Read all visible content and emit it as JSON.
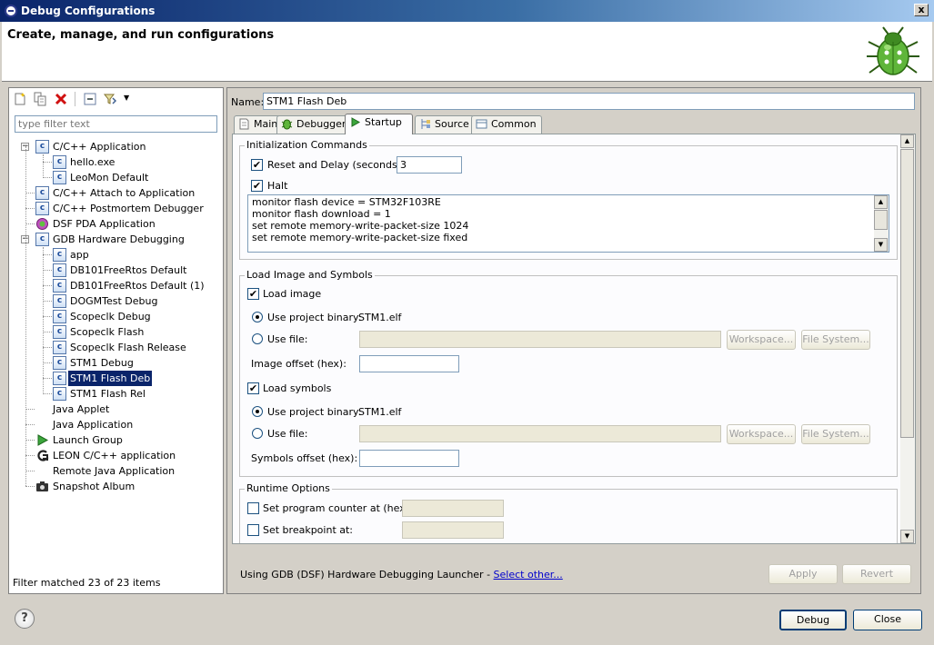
{
  "window": {
    "title": "Debug Configurations",
    "close_label": "x"
  },
  "header": {
    "title": "Create, manage, and run configurations"
  },
  "left": {
    "filter_placeholder": "type filter text",
    "filter_status": "Filter matched 23 of 23 items",
    "tree": [
      {
        "label": "C/C++ Application",
        "level": 0,
        "expanded": true,
        "icon": "c-config-icon"
      },
      {
        "label": "hello.exe",
        "level": 1,
        "icon": "c-config-icon"
      },
      {
        "label": "LeoMon Default",
        "level": 1,
        "icon": "c-config-icon"
      },
      {
        "label": "C/C++ Attach to Application",
        "level": 0,
        "icon": "c-config-icon"
      },
      {
        "label": "C/C++ Postmortem Debugger",
        "level": 0,
        "icon": "c-config-icon"
      },
      {
        "label": "DSF PDA Application",
        "level": 0,
        "icon": "pda-icon"
      },
      {
        "label": "GDB Hardware Debugging",
        "level": 0,
        "expanded": true,
        "icon": "c-config-icon"
      },
      {
        "label": "app",
        "level": 1,
        "icon": "c-config-icon"
      },
      {
        "label": "DB101FreeRtos Default",
        "level": 1,
        "icon": "c-config-icon"
      },
      {
        "label": "DB101FreeRtos Default (1)",
        "level": 1,
        "icon": "c-config-icon"
      },
      {
        "label": "DOGMTest Debug",
        "level": 1,
        "icon": "c-config-icon"
      },
      {
        "label": "Scopeclk Debug",
        "level": 1,
        "icon": "c-config-icon"
      },
      {
        "label": "Scopeclk Flash",
        "level": 1,
        "icon": "c-config-icon"
      },
      {
        "label": "Scopeclk Flash Release",
        "level": 1,
        "icon": "c-config-icon"
      },
      {
        "label": "STM1 Debug",
        "level": 1,
        "icon": "c-config-icon"
      },
      {
        "label": "STM1 Flash Deb",
        "level": 1,
        "icon": "c-config-icon",
        "selected": true
      },
      {
        "label": "STM1 Flash Rel",
        "level": 1,
        "icon": "c-config-icon"
      },
      {
        "label": "Java Applet",
        "level": 0,
        "icon": "java-applet-icon"
      },
      {
        "label": "Java Application",
        "level": 0,
        "icon": "java-app-icon"
      },
      {
        "label": "Launch Group",
        "level": 0,
        "icon": "launch-group-icon"
      },
      {
        "label": "LEON C/C++ application",
        "level": 0,
        "icon": "leon-icon"
      },
      {
        "label": "Remote Java Application",
        "level": 0,
        "icon": "remote-java-icon"
      },
      {
        "label": "Snapshot Album",
        "level": 0,
        "icon": "camera-icon"
      }
    ]
  },
  "right": {
    "name_label": "Name:",
    "name_value": "STM1 Flash Deb",
    "tabs": [
      {
        "label": "Main",
        "icon": "main-tab-icon"
      },
      {
        "label": "Debugger",
        "icon": "debugger-tab-icon"
      },
      {
        "label": "Startup",
        "icon": "startup-tab-icon",
        "active": true
      },
      {
        "label": "Source",
        "icon": "source-tab-icon"
      },
      {
        "label": "Common",
        "icon": "common-tab-icon"
      }
    ],
    "init": {
      "title": "Initialization Commands",
      "reset_label": "Reset and Delay (seconds):",
      "reset_checked": true,
      "delay_value": "3",
      "halt_label": "Halt",
      "halt_checked": true,
      "commands": [
        "monitor flash device = STM32F103RE",
        "monitor flash download = 1",
        "set remote memory-write-packet-size 1024",
        "set remote memory-write-packet-size fixed"
      ]
    },
    "load": {
      "title": "Load Image and Symbols",
      "load_image_label": "Load image",
      "use_project_binary_label": "Use project binary:",
      "project_binary": "STM1.elf",
      "use_file_label": "Use file:",
      "workspace_label": "Workspace...",
      "filesystem_label": "File System...",
      "image_offset_label": "Image offset (hex):",
      "load_symbols_label": "Load symbols",
      "symbols_binary": "STM1.elf",
      "symbols_offset_label": "Symbols offset (hex):"
    },
    "runtime": {
      "title": "Runtime Options",
      "set_pc_label": "Set program counter at (hex):",
      "set_bp_label": "Set breakpoint at:"
    },
    "launcher_text": "Using GDB (DSF) Hardware Debugging Launcher - ",
    "launcher_link": "Select other...",
    "apply_label": "Apply",
    "revert_label": "Revert"
  },
  "footer": {
    "help_label": "?",
    "debug_label": "Debug",
    "close_label": "Close"
  }
}
